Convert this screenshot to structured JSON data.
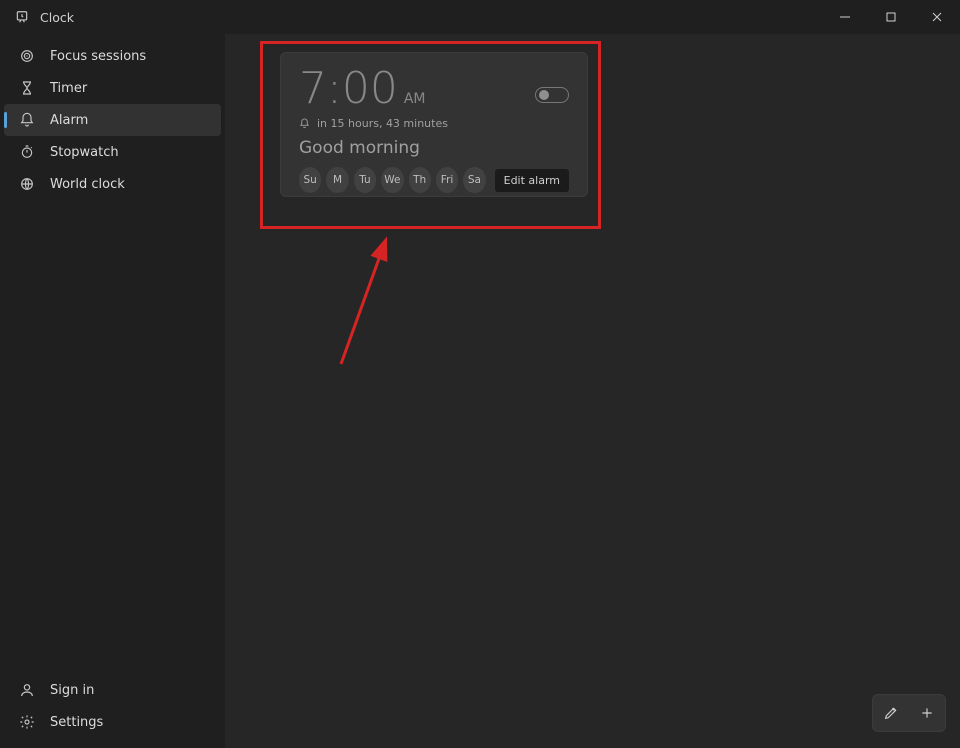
{
  "app": {
    "title": "Clock"
  },
  "nav": {
    "items": [
      {
        "label": "Focus sessions"
      },
      {
        "label": "Timer"
      },
      {
        "label": "Alarm"
      },
      {
        "label": "Stopwatch"
      },
      {
        "label": "World clock"
      }
    ],
    "bottom": {
      "signin": "Sign in",
      "settings": "Settings"
    }
  },
  "alarm": {
    "time": "7:00",
    "ampm": "AM",
    "countdown": "in 15 hours, 43 minutes",
    "name": "Good morning",
    "days": [
      "Su",
      "M",
      "Tu",
      "We",
      "Th",
      "Fri",
      "Sa"
    ],
    "tooltip": "Edit alarm",
    "enabled": false
  }
}
